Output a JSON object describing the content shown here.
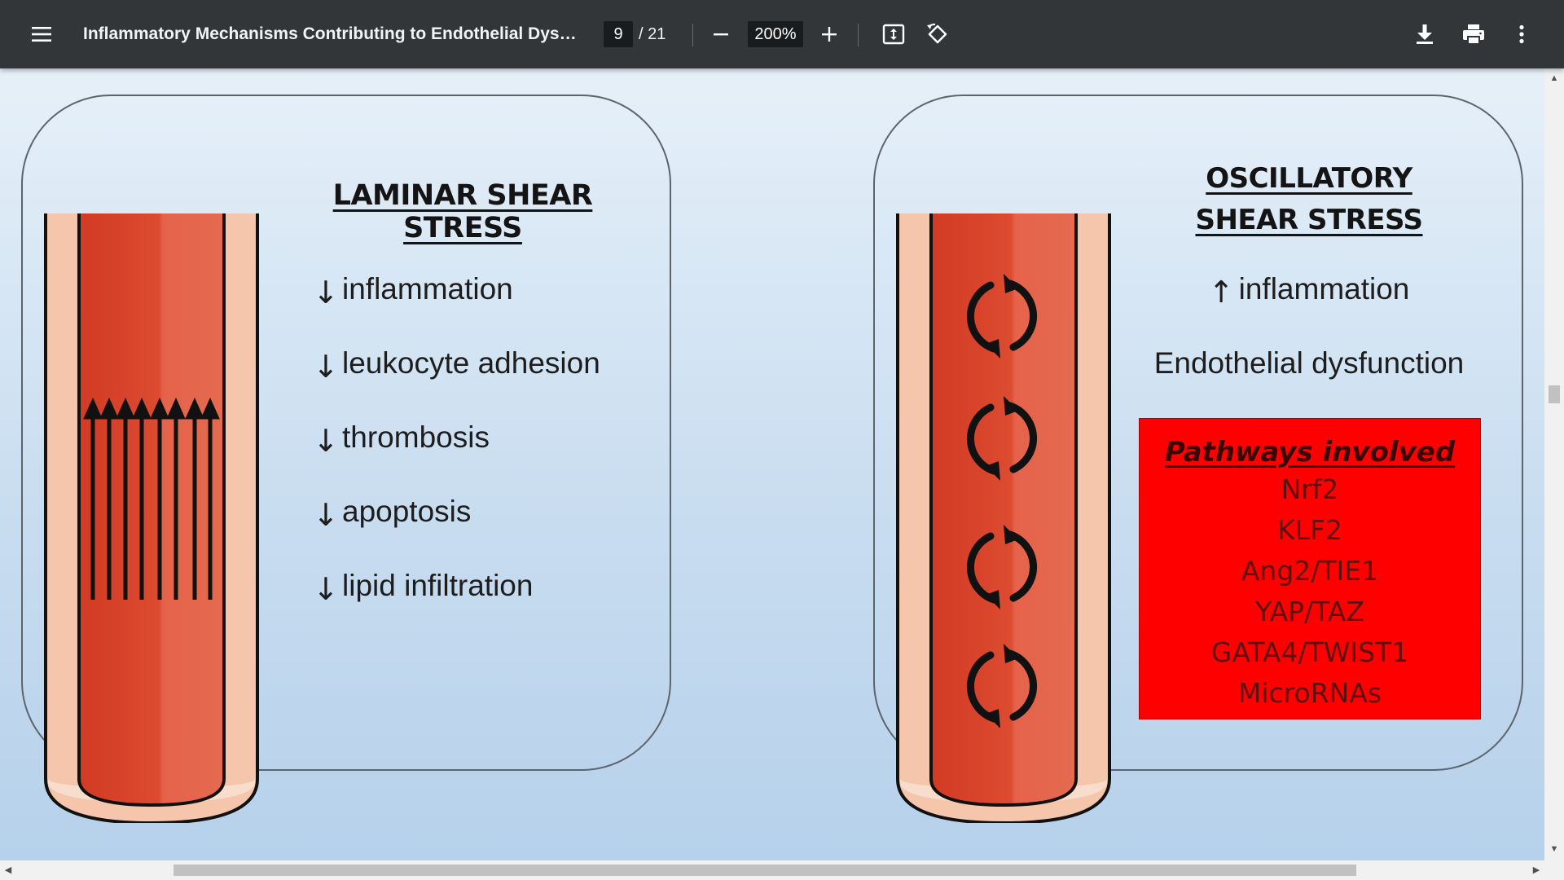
{
  "toolbar": {
    "document_title": "Inflammatory Mechanisms Contributing to Endothelial Dysfunct...",
    "current_page": "9",
    "page_total": "/ 21",
    "zoom_value": "200%",
    "icons": {
      "menu": "menu-icon",
      "zoom_out": "minus-icon",
      "zoom_in": "plus-icon",
      "fit": "fit-to-page-icon",
      "rotate": "rotate-icon",
      "download": "download-icon",
      "print": "print-icon",
      "more": "more-vert-icon"
    }
  },
  "slide": {
    "laminar": {
      "heading": "LAMINAR SHEAR STRESS",
      "effects": [
        {
          "arrow": "↓",
          "text": "inflammation"
        },
        {
          "arrow": "↓",
          "text": "leukocyte adhesion"
        },
        {
          "arrow": "↓",
          "text": "thrombosis"
        },
        {
          "arrow": "↓",
          "text": "apoptosis"
        },
        {
          "arrow": "↓",
          "text": "lipid infiltration"
        }
      ]
    },
    "oscillatory": {
      "heading_line1": "OSCILLATORY",
      "heading_line2": "SHEAR STRESS",
      "effect1_arrow": "↑",
      "effect1_text": "inflammation",
      "effect2_text": "Endothelial dysfunction",
      "pathways": {
        "title": "Pathways involved",
        "items": [
          "Nrf2",
          "KLF2",
          "Ang2/TIE1",
          "YAP/TAZ",
          "GATA4/TWIST1",
          "MicroRNAs"
        ]
      }
    }
  },
  "colors": {
    "toolbar_bg": "#323639",
    "vessel_outer": "#f4c3a8",
    "vessel_inner": "#d9432d",
    "pathways_bg": "#fe0000"
  }
}
